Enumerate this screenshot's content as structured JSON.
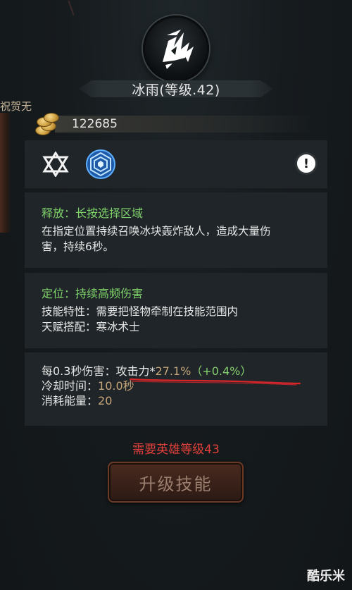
{
  "skill": {
    "title": "冰雨(等级.42)",
    "emblem_icon": "ice-shard-skill-icon"
  },
  "banner_text": "祝贺无",
  "currency": {
    "icon": "gold-coins-icon",
    "amount": "122685"
  },
  "tags": {
    "icons": [
      "hexagram-star-icon",
      "frost-rune-icon"
    ],
    "info_icon_glyph": "!"
  },
  "release": {
    "heading": "释放：长按选择区域",
    "description_line1": "在指定位置持续召唤冰块轰炸敌人，造成大量伤",
    "description_line2": "害，持续6秒。"
  },
  "positioning": {
    "heading": "定位：持续高频伤害",
    "trait": "技能特性：需要把怪物牵制在技能范围内",
    "talent": "天赋搭配：寒冰术士"
  },
  "stats": {
    "damage_label": "每0.3秒伤害：",
    "damage_attr": "攻击力*",
    "damage_value": "27.1%",
    "damage_bonus": "（+0.4%）",
    "cooldown_label": "冷却时间：",
    "cooldown_value": "10.0秒",
    "energy_label": "消耗能量：",
    "energy_value": "20"
  },
  "requirement": "需要英雄等级43",
  "upgrade_button": "升级技能",
  "watermark": "酷乐米",
  "colors": {
    "green_heading": "#7fd26a",
    "requirement_red": "#e2403a",
    "stat_value": "#c6a57a"
  }
}
